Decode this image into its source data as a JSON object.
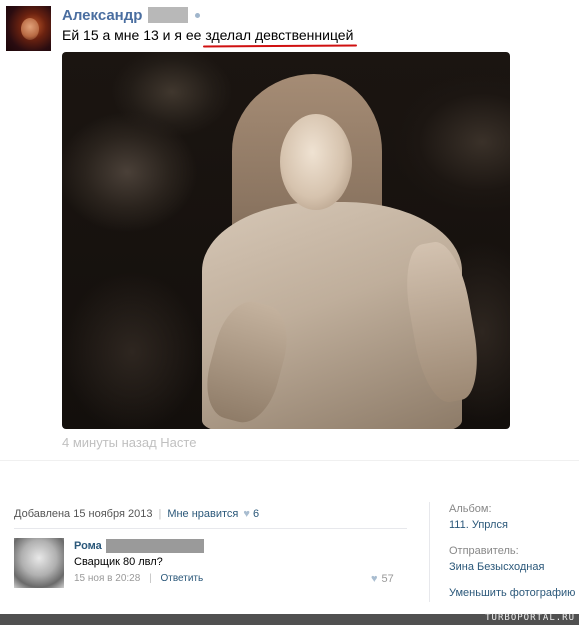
{
  "post": {
    "author": "Александр",
    "text_before": "Ей 15 а мне 13 и я ее ",
    "text_underlined": "зделал девственницей",
    "meta": "4 минуты назад Насте"
  },
  "photo_info": {
    "added": "Добавлена 15 ноября 2013",
    "like_label": "Мне нравится",
    "like_count": "6"
  },
  "comment": {
    "author": "Рома",
    "text": "Сварщик 80 лвл?",
    "time": "15 ноя в 20:28",
    "reply_label": "Ответить",
    "like_count": "57"
  },
  "sidebar": {
    "album_label": "Альбом:",
    "album_value": "111. Упрлся",
    "sender_label": "Отправитель:",
    "sender_value": "Зина Безысходная",
    "shrink_label": "Уменьшить фотографию"
  },
  "footer": {
    "watermark": "TURBOPORTAL.RU"
  },
  "colors": {
    "link": "#2b587a",
    "author": "#4a6ea0",
    "underline": "#d01010"
  }
}
